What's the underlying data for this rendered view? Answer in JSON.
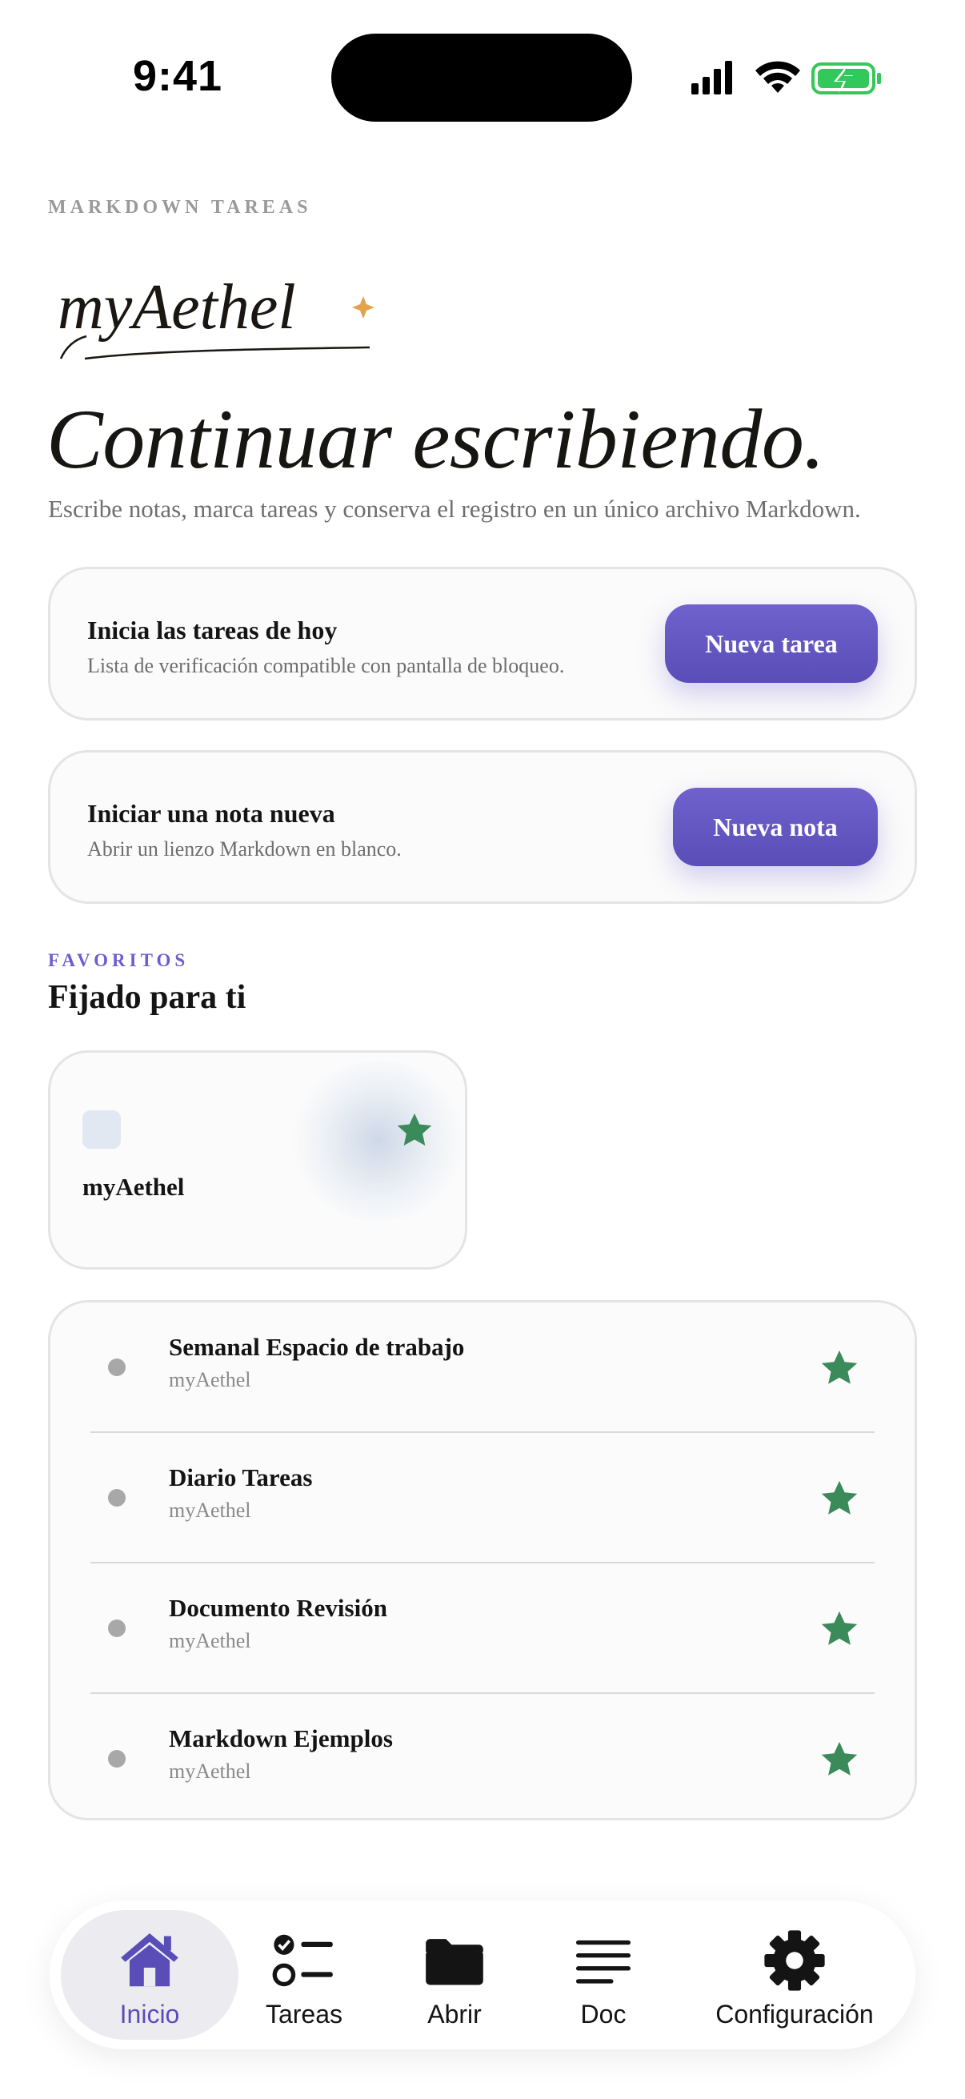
{
  "status_bar": {
    "time": "9:41"
  },
  "header": {
    "eyebrow": "MARKDOWN TAREAS",
    "logo_text": "myAethel"
  },
  "hero": {
    "title": "Continuar escribiendo.",
    "subtitle": "Escribe notas, marca tareas y conserva el registro en un único archivo Markdown."
  },
  "actions": [
    {
      "title": "Inicia las tareas de hoy",
      "subtitle": "Lista de verificación compatible con pantalla de bloqueo.",
      "button": "Nueva tarea"
    },
    {
      "title": "Iniciar una nota nueva",
      "subtitle": "Abrir un lienzo Markdown en blanco.",
      "button": "Nueva nota"
    }
  ],
  "favorites": {
    "eyebrow": "FAVORITOS",
    "heading": "Fijado para ti",
    "pinned": {
      "title": "myAethel",
      "star_icon": "star-icon"
    },
    "items": [
      {
        "title": "Semanal Espacio de trabajo",
        "subtitle": "myAethel"
      },
      {
        "title": "Diario Tareas",
        "subtitle": "myAethel"
      },
      {
        "title": "Documento Revisión",
        "subtitle": "myAethel"
      },
      {
        "title": "Markdown Ejemplos",
        "subtitle": "myAethel"
      }
    ]
  },
  "tabbar": {
    "tabs": [
      {
        "label": "Inicio",
        "icon": "house-icon",
        "active": true
      },
      {
        "label": "Tareas",
        "icon": "checklist-icon",
        "active": false
      },
      {
        "label": "Abrir",
        "icon": "folder-icon",
        "active": false
      },
      {
        "label": "Doc",
        "icon": "document-lines-icon",
        "active": false
      },
      {
        "label": "Configuración",
        "icon": "gear-icon",
        "active": false
      }
    ]
  },
  "colors": {
    "accent": "#5b4db8",
    "star": "#3b8a5a",
    "battery": "#34c759",
    "text": "#141414"
  }
}
